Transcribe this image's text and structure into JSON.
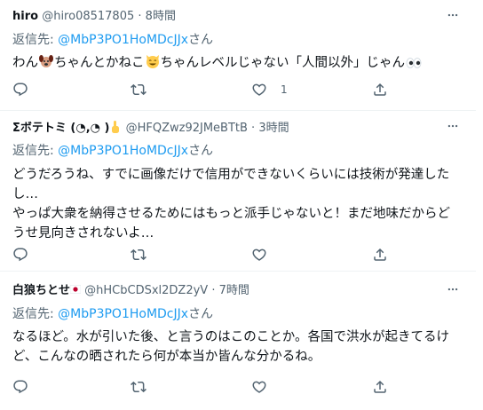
{
  "tweets": [
    {
      "name": "hiro",
      "handle": "@hiro08517805",
      "dot": "·",
      "time": "8時間",
      "reply_prefix": "返信先: ",
      "reply_mention": "@MbP3PO1HoMDcJJx",
      "reply_suffix": "さん",
      "text_parts": [
        "わん",
        "ちゃんとかねこ",
        "ちゃんレベルじゃない「人間以外」じゃん"
      ],
      "like_count": "1",
      "icons": [
        "dog-face-emoji",
        "grinning-cat-emoji",
        "eyes-emoji"
      ]
    },
    {
      "name": "Σボテトミ (◔,◔ )",
      "handle": "@HFQZwz92JMeBTtB",
      "dot": "·",
      "time": "3時間",
      "reply_prefix": "返信先: ",
      "reply_mention": "@MbP3PO1HoMDcJJx",
      "reply_suffix": "さん",
      "text": "どうだろうね、すでに画像だけで信用ができないくらいには技術が発達したし…\nやっぱ大衆を納得させるためにはもっと派手じゃないと！まだ地味だからどうせ見向きされないよ…",
      "icons": [
        "pointing-up-hand-emoji"
      ]
    },
    {
      "name": "白狼ちとせ",
      "handle": "@hHCbCDSxl2DZ2yV",
      "dot": "·",
      "time": "7時間",
      "reply_prefix": "返信先: ",
      "reply_mention": "@MbP3PO1HoMDcJJx",
      "reply_suffix": "さん",
      "text": "なるほど。水が引いた後、と言うのはこのことか。各国で洪水が起きてるけど、こんなの晒されたら何が本当か皆んな分かるね。",
      "icons": [
        "japan-flag-emoji"
      ]
    }
  ],
  "colors": {
    "text": "#0f1419",
    "secondary": "#536471",
    "link": "#1d9bf0",
    "divider": "#eff3f4"
  }
}
